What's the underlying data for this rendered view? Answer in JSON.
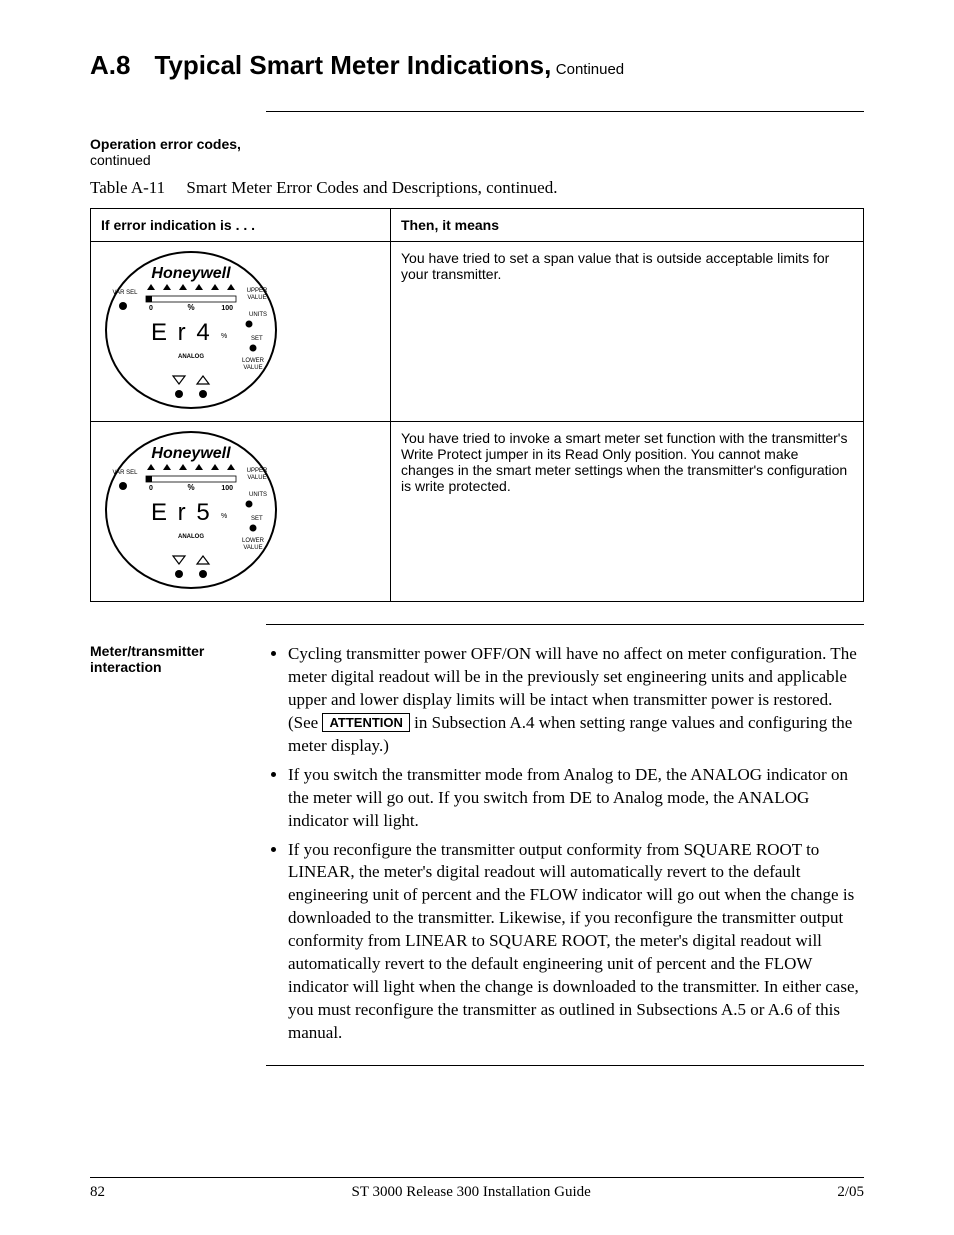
{
  "heading": {
    "number": "A.8",
    "title": "Typical Smart Meter Indications,",
    "continued": "Continued"
  },
  "subhead": {
    "bold": "Operation error codes,",
    "cont": "continued"
  },
  "table": {
    "caption_prefix": "Table A-11",
    "caption_text": "Smart Meter Error Codes and Descriptions, continued.",
    "headers": [
      "If error indication is . . .",
      "Then, it means"
    ],
    "rows": [
      {
        "meter": {
          "brand": "Honeywell",
          "display_code": "E r 4",
          "labels": {
            "var_sel": "VAR SEL",
            "upper_value": "UPPER VALUE",
            "percent": "%",
            "zero": "0",
            "hundred": "100",
            "units": "UNITS",
            "set": "SET",
            "lower_value": "LOWER VALUE",
            "analog": "ANALOG"
          }
        },
        "desc": "You have tried to set a span value that is outside acceptable limits for your transmitter."
      },
      {
        "meter": {
          "brand": "Honeywell",
          "display_code": "E r 5",
          "labels": {
            "var_sel": "VAR SEL",
            "upper_value": "UPPER VALUE",
            "percent": "%",
            "zero": "0",
            "hundred": "100",
            "units": "UNITS",
            "set": "SET",
            "lower_value": "LOWER VALUE",
            "analog": "ANALOG"
          }
        },
        "desc": "You have tried to invoke a smart meter set function with the transmitter's Write Protect jumper in its Read Only position. You cannot make changes in the smart meter settings when the transmitter's configuration is write protected."
      }
    ]
  },
  "section2": {
    "left_label": "Meter/transmitter interaction",
    "bullets": {
      "b1a": "Cycling transmitter power OFF/ON will have no affect on meter configuration.  The meter digital readout will be in the previously set engineering units and applicable upper and lower display limits will be intact when transmitter power is restored.  (See ",
      "attention": "ATTENTION",
      "b1b": " in Subsection A.4 when setting range values and configuring the meter display.)",
      "b2": "If you switch the transmitter mode from Analog to DE, the ANALOG indicator on the meter will go out. If you switch from DE to Analog mode, the ANALOG indicator will light.",
      "b3": "If you reconfigure the transmitter output conformity from SQUARE ROOT to LINEAR, the meter's digital readout will automatically revert to the default engineering unit of percent and the FLOW indicator will go out when the change is downloaded to the transmitter. Likewise, if you reconfigure the transmitter output conformity from LINEAR to SQUARE ROOT, the meter's digital readout will automatically revert to the default engineering unit of percent and the FLOW indicator will light when the change is downloaded to the transmitter. In either case, you must reconfigure the transmitter as outlined in Subsections A.5 or A.6 of this manual."
    }
  },
  "footer": {
    "page": "82",
    "center": "ST 3000 Release 300 Installation Guide",
    "right": "2/05"
  }
}
